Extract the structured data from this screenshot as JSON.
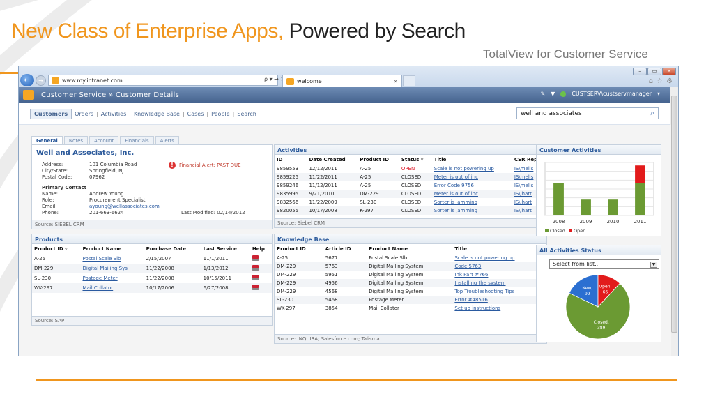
{
  "slide": {
    "title_accent": "New Class of Enterprise Apps,",
    "title_main": "Powered by Search",
    "subtitle": "TotalView for Customer Service",
    "accent_color": "#f0961e"
  },
  "browser": {
    "url": "www.my.intranet.com",
    "url_controls": "ρ ▾ → ✕",
    "tab_title": "welcome",
    "tab_close": "×",
    "chrome_icons": [
      "home-icon",
      "star-icon",
      "gear-icon"
    ]
  },
  "app": {
    "breadcrumb": "Customer Service  »  Customer Details",
    "user": "CUSTSERV\\custservmanager",
    "user_caret": "▾",
    "nav": {
      "selected": "Customers",
      "links": [
        "Orders",
        "Activities",
        "Knowledge Base",
        "Cases",
        "People",
        "Search"
      ]
    },
    "search": {
      "value": "well and associates"
    }
  },
  "general": {
    "tabs": [
      "General",
      "Notes",
      "Account",
      "Financials",
      "Alerts"
    ],
    "company": "Well and Associates, Inc.",
    "address_label": "Address:",
    "address": "101 Columbia Road",
    "citystate_label": "City/State:",
    "citystate": "Springfield, NJ",
    "postal_label": "Postal Code:",
    "postal": "07962",
    "alert": "Financial Alert: PAST DUE",
    "primary_contact_label": "Primary Contact",
    "name_label": "Name:",
    "name": "Andrew Young",
    "role_label": "Role:",
    "role": "Procurement Specialist",
    "email_label": "Email:",
    "email": "ayoung@wellassociates.com",
    "phone_label": "Phone:",
    "phone": "201-663-6624",
    "last_modified": "Last Modified: 02/14/2012",
    "source": "Source: SIEBEL CRM"
  },
  "products": {
    "title": "Products",
    "columns": [
      "Product ID",
      "Product Name",
      "Purchase Date",
      "Last Service",
      "Help"
    ],
    "rows": [
      {
        "id": "A-25",
        "name": "Postal Scale Slb",
        "purchase": "2/15/2007",
        "service": "11/1/2011"
      },
      {
        "id": "DM-229",
        "name": "Digital Mailing Sys",
        "purchase": "11/22/2008",
        "service": "1/13/2012"
      },
      {
        "id": "SL-230",
        "name": "Postage Meter",
        "purchase": "11/22/2008",
        "service": "10/15/2011"
      },
      {
        "id": "WK-297",
        "name": "Mail Collator",
        "purchase": "10/17/2006",
        "service": "6/27/2008"
      }
    ],
    "source": "Source: SAP"
  },
  "activities": {
    "title": "Activities",
    "columns": [
      "ID",
      "Date Created",
      "Product ID",
      "Status",
      "Title",
      "CSR Rep"
    ],
    "rows": [
      {
        "id": "9859553",
        "date": "12/12/2011",
        "product": "A-25",
        "status": "OPEN",
        "title": "Scale is not powering up",
        "rep": "IS\\melis"
      },
      {
        "id": "9859225",
        "date": "11/22/2011",
        "product": "A-25",
        "status": "CLOSED",
        "title": "Meter is out of inc",
        "rep": "IS\\melis"
      },
      {
        "id": "9859246",
        "date": "11/12/2011",
        "product": "A-25",
        "status": "CLOSED",
        "title": "Error Code 9756",
        "rep": "IS\\melis"
      },
      {
        "id": "9835995",
        "date": "9/21/2010",
        "product": "DM-229",
        "status": "CLOSED",
        "title": "Meter is out of inc",
        "rep": "IS\\jhart"
      },
      {
        "id": "9832566",
        "date": "11/22/2009",
        "product": "SL-230",
        "status": "CLOSED",
        "title": "Sorter is jamming",
        "rep": "IS\\jhart"
      },
      {
        "id": "9820055",
        "date": "10/17/2008",
        "product": "K-297",
        "status": "CLOSED",
        "title": "Sorter is jamming",
        "rep": "IS\\jhart"
      }
    ],
    "source": "Source: Siebel CRM"
  },
  "knowledge": {
    "title": "Knowledge Base",
    "columns": [
      "Product ID",
      "Article ID",
      "Product Name",
      "Title"
    ],
    "rows": [
      {
        "pid": "A-25",
        "aid": "5677",
        "name": "Postal Scale Slb",
        "title": "Scale is not powering up"
      },
      {
        "pid": "DM-229",
        "aid": "5763",
        "name": "Digital Mailing System",
        "title": "Code 5763"
      },
      {
        "pid": "DM-229",
        "aid": "5951",
        "name": "Digital Mailing System",
        "title": "Ink Part #766"
      },
      {
        "pid": "DM-229",
        "aid": "4956",
        "name": "Digital Mailing System",
        "title": "Installing the system"
      },
      {
        "pid": "DM-229",
        "aid": "4568",
        "name": "Digital Mailing System",
        "title": "Top Troubleshooting Tips"
      },
      {
        "pid": "SL-230",
        "aid": "5468",
        "name": "Postage Meter",
        "title": "Error #48516"
      },
      {
        "pid": "WK-297",
        "aid": "3854",
        "name": "Mail Collator",
        "title": "Set up instructions"
      }
    ],
    "source": "Source: INQUIRA; Salesforce.com; Talisma"
  },
  "customer_activities": {
    "title": "Customer Activities",
    "legend_closed": "Closed",
    "legend_open": "Open",
    "closed_color": "#6b9a33",
    "open_color": "#e21b1b"
  },
  "all_status": {
    "title": "All Activities Status",
    "select_value": "Select from list...",
    "label_closed": "Closed,",
    "value_closed": "389",
    "label_new": "New,",
    "value_new": "99",
    "label_open": "Open,",
    "value_open": "66"
  },
  "chart_data": [
    {
      "type": "bar",
      "categories": [
        "2008",
        "2009",
        "2010",
        "2011"
      ],
      "series": [
        {
          "name": "Closed",
          "values": [
            55,
            27,
            27,
            55
          ]
        },
        {
          "name": "Open",
          "values": [
            0,
            0,
            0,
            30
          ]
        }
      ],
      "stacked": true,
      "ylim": [
        0,
        90
      ],
      "grid": true,
      "legend": "bottom-left"
    },
    {
      "type": "pie",
      "labels": [
        "Closed",
        "New",
        "Open"
      ],
      "values": [
        389,
        99,
        66
      ],
      "colors": [
        "#6b9a33",
        "#2b6fd1",
        "#e21b1b"
      ]
    }
  ]
}
